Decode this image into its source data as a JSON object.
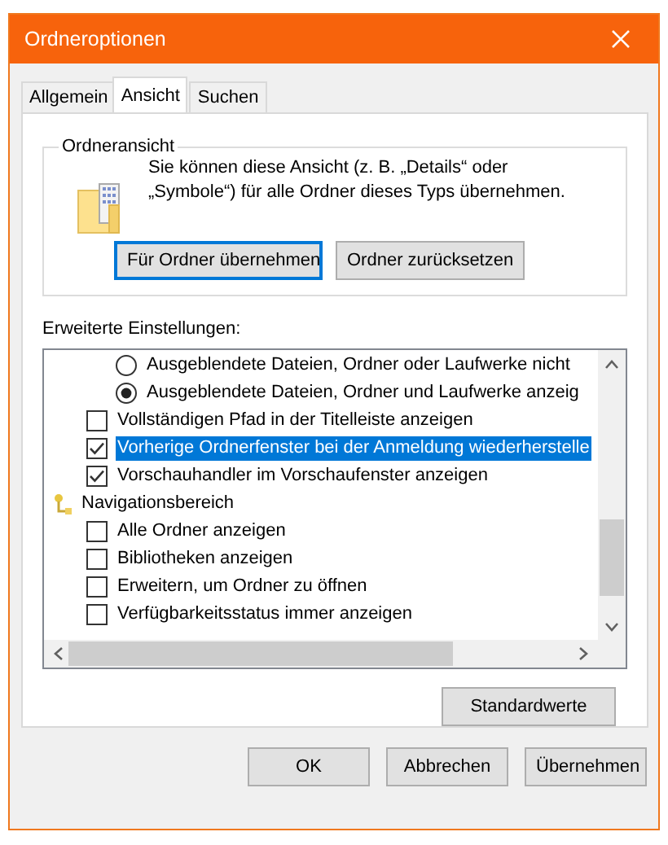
{
  "window": {
    "title": "Ordneroptionen"
  },
  "tabs": [
    {
      "label": "Allgemein",
      "selected": false
    },
    {
      "label": "Ansicht",
      "selected": true
    },
    {
      "label": "Suchen",
      "selected": false
    }
  ],
  "folder_view": {
    "title": "Ordneransicht",
    "description": "Sie können diese Ansicht (z. B. „Details“ oder „Symbole“) für alle Ordner dieses Typs übernehmen.",
    "buttons": [
      {
        "label": "Für Ordner übernehmen",
        "focused": true
      },
      {
        "label": "Ordner zurücksetzen",
        "focused": false
      }
    ]
  },
  "advanced": {
    "label": "Erweiterte Einstellungen:",
    "items": [
      {
        "kind": "radio",
        "label": "Ausgeblendete Dateien, Ordner oder Laufwerke nicht",
        "checked": false,
        "selected": false
      },
      {
        "kind": "radio",
        "label": "Ausgeblendete Dateien, Ordner und Laufwerke anzeig",
        "checked": true,
        "selected": false
      },
      {
        "kind": "checkbox",
        "label": "Vollständigen Pfad in der Titelleiste anzeigen",
        "checked": false,
        "selected": false
      },
      {
        "kind": "checkbox",
        "label": "Vorherige Ordnerfenster bei der Anmeldung wiederherstelle",
        "checked": true,
        "selected": true
      },
      {
        "kind": "checkbox",
        "label": "Vorschauhandler im Vorschaufenster anzeigen",
        "checked": true,
        "selected": false
      },
      {
        "kind": "group",
        "label": "Navigationsbereich",
        "selected": false
      },
      {
        "kind": "checkbox",
        "label": "Alle Ordner anzeigen",
        "checked": false,
        "selected": false
      },
      {
        "kind": "checkbox",
        "label": "Bibliotheken anzeigen",
        "checked": false,
        "selected": false
      },
      {
        "kind": "checkbox",
        "label": "Erweitern, um Ordner zu öffnen",
        "checked": false,
        "selected": false
      },
      {
        "kind": "checkbox",
        "label": "Verfügbarkeitsstatus immer anzeigen",
        "checked": false,
        "selected": false
      }
    ]
  },
  "defaults_button": "Standardwerte",
  "footer_buttons": [
    "OK",
    "Abbrechen",
    "Übernehmen"
  ]
}
